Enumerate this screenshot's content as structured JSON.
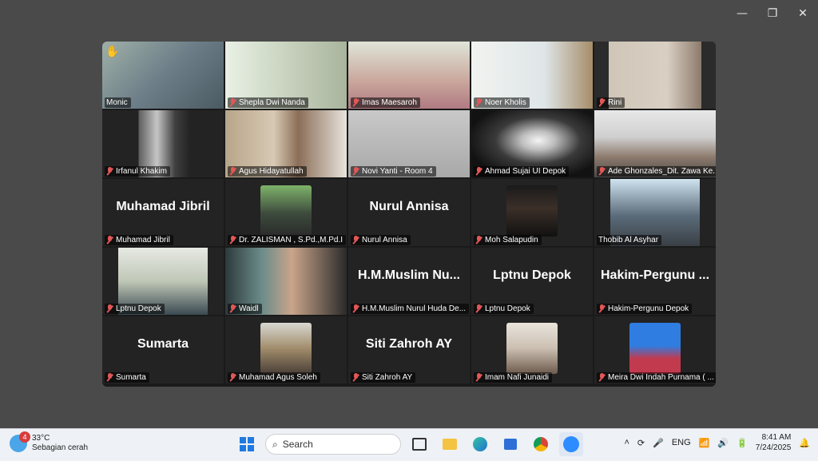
{
  "window": {
    "minimize_icon": "—",
    "restore_icon": "❐",
    "close_icon": "✕"
  },
  "participants": [
    {
      "name": "Monic",
      "muted": false,
      "hand": "✋"
    },
    {
      "name": "Shepla Dwi Nanda",
      "muted": true
    },
    {
      "name": "Imas Maesaroh",
      "muted": true,
      "speaking": true
    },
    {
      "name": "Noer Kholis",
      "muted": true
    },
    {
      "name": "Rini",
      "muted": true
    },
    {
      "name": "Irfanul Khakim",
      "muted": true
    },
    {
      "name": "Agus Hidayatullah",
      "muted": true
    },
    {
      "name": "Novi Yanti - Room 4",
      "muted": true
    },
    {
      "name": "Ahmad Sujai UI Depok",
      "muted": true
    },
    {
      "name": "Ade Ghonzales_Dit. Zawa Ke...",
      "muted": true
    },
    {
      "name": "Muhamad Jibril",
      "big": "Muhamad Jibril",
      "muted": true
    },
    {
      "name": "Dr. ZALISMAN , S.Pd.,M.Pd.I",
      "muted": true
    },
    {
      "name": "Nurul Annisa",
      "big": "Nurul Annisa",
      "muted": true
    },
    {
      "name": "Moh Salapudin",
      "muted": true
    },
    {
      "name": "Thobib Al Asyhar",
      "muted": false
    },
    {
      "name": "Lptnu Depok",
      "muted": true
    },
    {
      "name": "Waidl",
      "muted": true
    },
    {
      "name": "H.M.Muslim Nurul Huda De...",
      "big": "H.M.Muslim  Nu...",
      "muted": true
    },
    {
      "name": "Lptnu Depok",
      "big": "Lptnu Depok",
      "muted": true
    },
    {
      "name": "Hakim-Pergunu Depok",
      "big": "Hakim-Pergunu ...",
      "muted": true
    },
    {
      "name": "Sumarta",
      "big": "Sumarta",
      "muted": true
    },
    {
      "name": "Muhamad Agus Soleh",
      "muted": true
    },
    {
      "name": "Siti Zahroh AY",
      "big": "Siti Zahroh AY",
      "muted": true
    },
    {
      "name": "Imam Nafi Junaidi",
      "muted": true
    },
    {
      "name": "Meira Dwi Indah Purnama ( ...",
      "muted": true
    }
  ],
  "taskbar": {
    "weather_temp": "33°C",
    "weather_desc": "Sebagian cerah",
    "weather_badge": "4",
    "search_label": "Search",
    "lang": "ENG",
    "time": "8:41 AM",
    "date": "7/24/2025"
  }
}
